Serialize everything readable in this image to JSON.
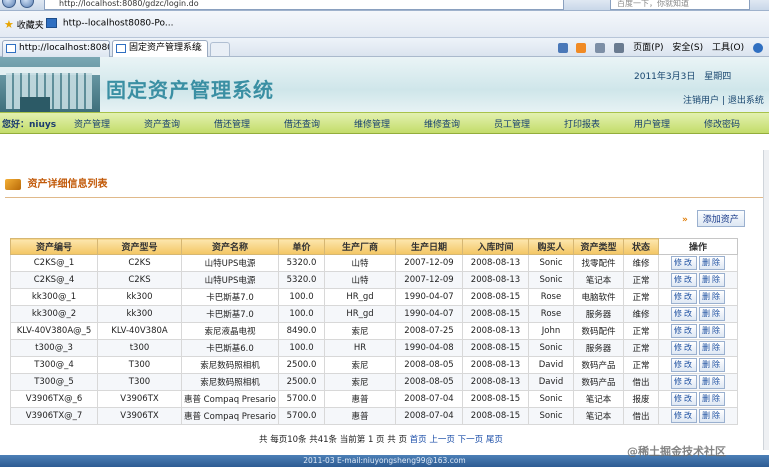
{
  "browser": {
    "url": "http://localhost:8080/gdzc/login.do",
    "search_placeholder": "百度一下，你就知道",
    "favorites_label": "收藏夹",
    "fav_link": "http--localhost8080-Po...",
    "tabs": [
      {
        "label": "http://localhost:8080/Po..."
      },
      {
        "label": "固定资产管理系统"
      }
    ],
    "tab_close": "×",
    "toolbar": {
      "page": "页面(P)",
      "safety": "安全(S)",
      "tools": "工具(O)",
      "help": "?"
    }
  },
  "header": {
    "title": "固定资产管理系统",
    "date": "2011年3月3日",
    "weekday": "星期四",
    "logout_user": "注销用户",
    "exit_system": "退出系统",
    "separator": "|"
  },
  "nav": {
    "greeting": "您好：niuys",
    "items": [
      "资产管理",
      "资产查询",
      "借还管理",
      "借还查询",
      "维修管理",
      "维修查询",
      "员工管理",
      "打印报表",
      "用户管理",
      "修改密码"
    ]
  },
  "section": {
    "title": "资产详细信息列表",
    "add_label": "添加资产",
    "add_arrow": "»"
  },
  "table": {
    "headers": [
      "资产编号",
      "资产型号",
      "资产名称",
      "单价",
      "生产厂商",
      "生产日期",
      "入库时间",
      "购买人",
      "资产类型",
      "状态",
      "操作"
    ],
    "edit_label": "修改",
    "delete_label": "删除",
    "rows": [
      [
        "C2KS@_1",
        "C2KS",
        "山特UPS电源",
        "5320.0",
        "山特",
        "2007-12-09",
        "2008-08-13",
        "Sonic",
        "找零配件",
        "维修"
      ],
      [
        "C2KS@_4",
        "C2KS",
        "山特UPS电源",
        "5320.0",
        "山特",
        "2007-12-09",
        "2008-08-13",
        "Sonic",
        "笔记本",
        "正常"
      ],
      [
        "kk300@_1",
        "kk300",
        "卡巴斯基7.0",
        "100.0",
        "HR_gd",
        "1990-04-07",
        "2008-08-15",
        "Rose",
        "电脑软件",
        "正常"
      ],
      [
        "kk300@_2",
        "kk300",
        "卡巴斯基7.0",
        "100.0",
        "HR_gd",
        "1990-04-07",
        "2008-08-15",
        "Rose",
        "服务器",
        "维修"
      ],
      [
        "KLV-40V380A@_5",
        "KLV-40V380A",
        "索尼液晶电视",
        "8490.0",
        "索尼",
        "2008-07-25",
        "2008-08-13",
        "John",
        "数码配件",
        "正常"
      ],
      [
        "t300@_3",
        "t300",
        "卡巴斯基6.0",
        "100.0",
        "HR",
        "1990-04-08",
        "2008-08-15",
        "Sonic",
        "服务器",
        "正常"
      ],
      [
        "T300@_4",
        "T300",
        "索尼数码照相机",
        "2500.0",
        "索尼",
        "2008-08-05",
        "2008-08-13",
        "David",
        "数码产品",
        "正常"
      ],
      [
        "T300@_5",
        "T300",
        "索尼数码照相机",
        "2500.0",
        "索尼",
        "2008-08-05",
        "2008-08-13",
        "David",
        "数码产品",
        "借出"
      ],
      [
        "V3906TX@_6",
        "V3906TX",
        "惠普 Compaq Presario",
        "5700.0",
        "惠普",
        "2008-07-04",
        "2008-08-15",
        "Sonic",
        "笔记本",
        "报废"
      ],
      [
        "V3906TX@_7",
        "V3906TX",
        "惠普 Compaq Presario",
        "5700.0",
        "惠普",
        "2008-07-04",
        "2008-08-15",
        "Sonic",
        "笔记本",
        "借出"
      ]
    ]
  },
  "pager": {
    "summary": "共 每页10条 共41条 当前第 1 页 共 页",
    "first": "首页",
    "prev": "上一页",
    "next": "下一页",
    "last": "尾页"
  },
  "footer": {
    "text": "2011-03 E-mail:niuyongsheng99@163.com"
  },
  "watermark": "@稀土掘金技术社区"
}
